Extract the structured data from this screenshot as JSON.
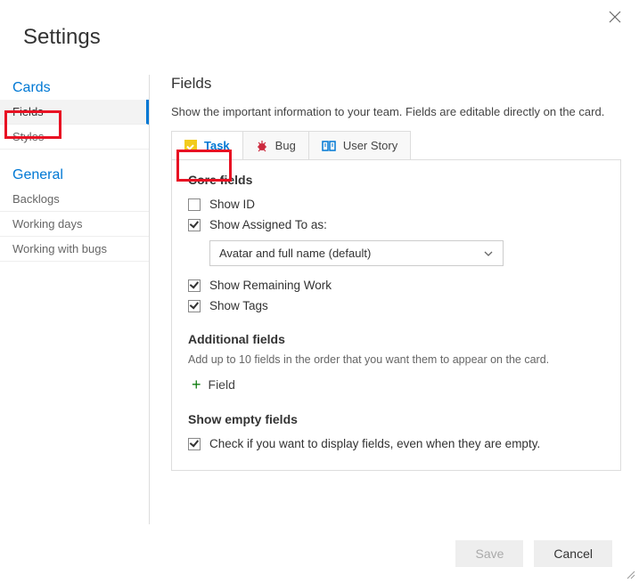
{
  "title": "Settings",
  "sidebar": {
    "groups": [
      {
        "heading": "Cards",
        "items": [
          {
            "label": "Fields",
            "active": true
          },
          {
            "label": "Styles"
          }
        ]
      },
      {
        "heading": "General",
        "items": [
          {
            "label": "Backlogs"
          },
          {
            "label": "Working days"
          },
          {
            "label": "Working with bugs"
          }
        ]
      }
    ]
  },
  "main": {
    "heading": "Fields",
    "description": "Show the important information to your team. Fields are editable directly on the card.",
    "tabs": [
      {
        "label": "Task",
        "icon": "task-icon",
        "active": true
      },
      {
        "label": "Bug",
        "icon": "bug-icon"
      },
      {
        "label": "User Story",
        "icon": "story-icon"
      }
    ],
    "core": {
      "title": "Core fields",
      "show_id": {
        "label": "Show ID",
        "checked": false
      },
      "show_assigned": {
        "label": "Show Assigned To as:",
        "checked": true
      },
      "assigned_dropdown": "Avatar and full name (default)",
      "show_remaining": {
        "label": "Show Remaining Work",
        "checked": true
      },
      "show_tags": {
        "label": "Show Tags",
        "checked": true
      }
    },
    "additional": {
      "title": "Additional fields",
      "subtext": "Add up to 10 fields in the order that you want them to appear on the card.",
      "add_label": "Field"
    },
    "empty": {
      "title": "Show empty fields",
      "label": "Check if you want to display fields, even when they are empty.",
      "checked": true
    }
  },
  "footer": {
    "save": "Save",
    "cancel": "Cancel"
  }
}
